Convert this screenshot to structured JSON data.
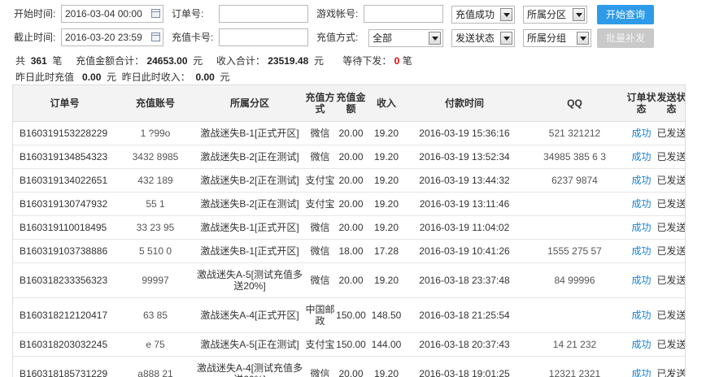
{
  "filters": {
    "start_time_label": "开始时间:",
    "start_time_value": "2016-03-04 00:00",
    "end_time_label": "截止时间:",
    "end_time_value": "2016-03-20 23:59",
    "order_no_label": "订单号:",
    "order_no_value": "",
    "card_no_label": "充值卡号:",
    "card_no_value": "",
    "game_account_label": "游戏帐号:",
    "game_account_value": "",
    "pay_method_label": "充值方式:",
    "pay_method_value": "全部",
    "status_select": "充值成功",
    "send_status_select": "发送状态",
    "zone_select": "所属分区",
    "group_select": "所属分组",
    "search_button": "开始查询",
    "batch_button": "批量补发"
  },
  "summary": {
    "total_prefix": "共",
    "total_count": "361",
    "total_suffix": "笔",
    "amount_label": "充值金额合计：",
    "amount_value": "24653.00",
    "amount_unit": "元",
    "income_label": "收入合计：",
    "income_value": "23519.48",
    "income_unit": "元",
    "pending_label": "等待下发：",
    "pending_value": "0",
    "pending_unit": "笔",
    "yesterday_recharge_label": "昨日此时充值",
    "yesterday_recharge_value": "0.00",
    "yesterday_recharge_unit": "元",
    "yesterday_income_label": "昨日此时收入：",
    "yesterday_income_value": "0.00",
    "yesterday_income_unit": "元"
  },
  "table": {
    "headers": [
      "订单号",
      "充值账号",
      "所属分区",
      "充值方式",
      "充值金额",
      "收入",
      "付款时间",
      "QQ",
      "订单状态",
      "发送状态"
    ],
    "rows": [
      [
        "B160319153228229",
        "1 ?99o",
        "激战迷失B-1[正式开区]",
        "微信",
        "20.00",
        "19.20",
        "2016-03-19 15:36:16",
        "521 321212",
        "成功",
        "已发送"
      ],
      [
        "B160319134854323",
        "3432 8985",
        "激战迷失B-2[正在测试]",
        "微信",
        "20.00",
        "19.20",
        "2016-03-19 13:52:34",
        "34985 385 6 3",
        "成功",
        "已发送"
      ],
      [
        "B160319134022651",
        "432 189",
        "激战迷失B-2[正在测试]",
        "支付宝",
        "20.00",
        "19.20",
        "2016-03-19 13:44:32",
        "6237 9874",
        "成功",
        "已发送"
      ],
      [
        "B160319130747932",
        "55 1",
        "激战迷失B-2[正在测试]",
        "支付宝",
        "20.00",
        "19.20",
        "2016-03-19 13:11:46",
        "",
        "成功",
        "已发送"
      ],
      [
        "B160319110018495",
        "33 23 95",
        "激战迷失B-1[正式开区]",
        "微信",
        "20.00",
        "19.20",
        "2016-03-19 11:04:02",
        "",
        "成功",
        "已发送"
      ],
      [
        "B160319103738886",
        "5 510 0",
        "激战迷失B-1[正式开区]",
        "微信",
        "18.00",
        "17.28",
        "2016-03-19 10:41:26",
        "1555 275 57",
        "成功",
        "已发送"
      ],
      [
        "B160318233356323",
        "99997",
        "激战迷失A-5[测试充值多送20%]",
        "微信",
        "20.00",
        "19.20",
        "2016-03-18 23:37:48",
        "84 99996",
        "成功",
        "已发送"
      ],
      [
        "B160318212120417",
        "63 85",
        "激战迷失A-4[正式开区]",
        "中国邮政",
        "150.00",
        "148.50",
        "2016-03-18 21:25:54",
        "",
        "成功",
        "已发送"
      ],
      [
        "B160318203032245",
        "e 75",
        "激战迷失A-5[正在测试]",
        "支付宝",
        "150.00",
        "144.00",
        "2016-03-18 20:37:43",
        "14 21 232",
        "成功",
        "已发送"
      ],
      [
        "B160318185731229",
        "a888 21",
        "激战迷失A-4[测试充值多送20%]",
        "微信",
        "20.00",
        "19.20",
        "2016-03-18 19:01:25",
        "12321 2321",
        "成功",
        "已发送"
      ]
    ]
  }
}
